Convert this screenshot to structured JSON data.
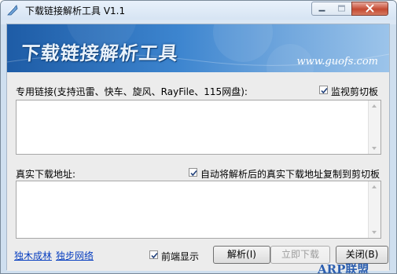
{
  "window": {
    "title": "下载链接解析工具 V1.1",
    "icon": "app-icon"
  },
  "banner": {
    "title": "下载链接解析工具",
    "url": "www.guofs.com"
  },
  "link_section": {
    "label": "专用链接(支持迅雷、快车、旋风、RayFile、115网盘):",
    "monitor_clipboard_label": "监视剪切板",
    "monitor_clipboard_checked": true,
    "value": ""
  },
  "real_section": {
    "label": "真实下载地址:",
    "auto_copy_label": "自动将解析后的真实下载地址复制到剪切板",
    "auto_copy_checked": true,
    "value": ""
  },
  "footer": {
    "links": [
      "独木成林",
      "独步网络"
    ],
    "topmost_label": "前端显示",
    "topmost_checked": true,
    "parse_label": "解析(I)",
    "download_label": "立即下载",
    "download_enabled": false,
    "close_label": "关闭(B)"
  },
  "watermark": "ARP联盟",
  "colors": {
    "banner_dark": "#1e5ca6",
    "banner_light": "#9cc4ea",
    "link": "#0a40c0",
    "close_red": "#c44a32"
  }
}
